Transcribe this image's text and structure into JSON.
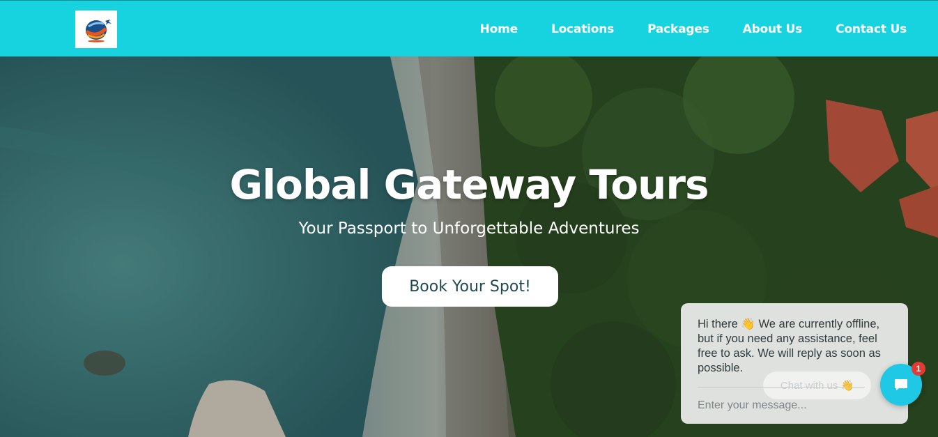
{
  "nav": {
    "logo_icon": "globe-plane-logo-icon",
    "links": [
      "Home",
      "Locations",
      "Packages",
      "About Us",
      "Contact Us"
    ]
  },
  "hero": {
    "title": "Global Gateway Tours",
    "subtitle": "Your Passport to Unforgettable Adventures",
    "cta": "Book Your Spot!"
  },
  "chat": {
    "message": "Hi there 👋 We are currently offline, but if you need any assistance, feel free to ask. We will reply as soon as possible.",
    "ghost_label": "Chat with us 👋",
    "input_placeholder": "Enter your message...",
    "badge_count": "1",
    "fab_icon": "chat-bubble-icon"
  },
  "colors": {
    "nav_bg": "#17d3e0",
    "chat_fab": "#1fc9e6",
    "badge": "#e53935"
  }
}
